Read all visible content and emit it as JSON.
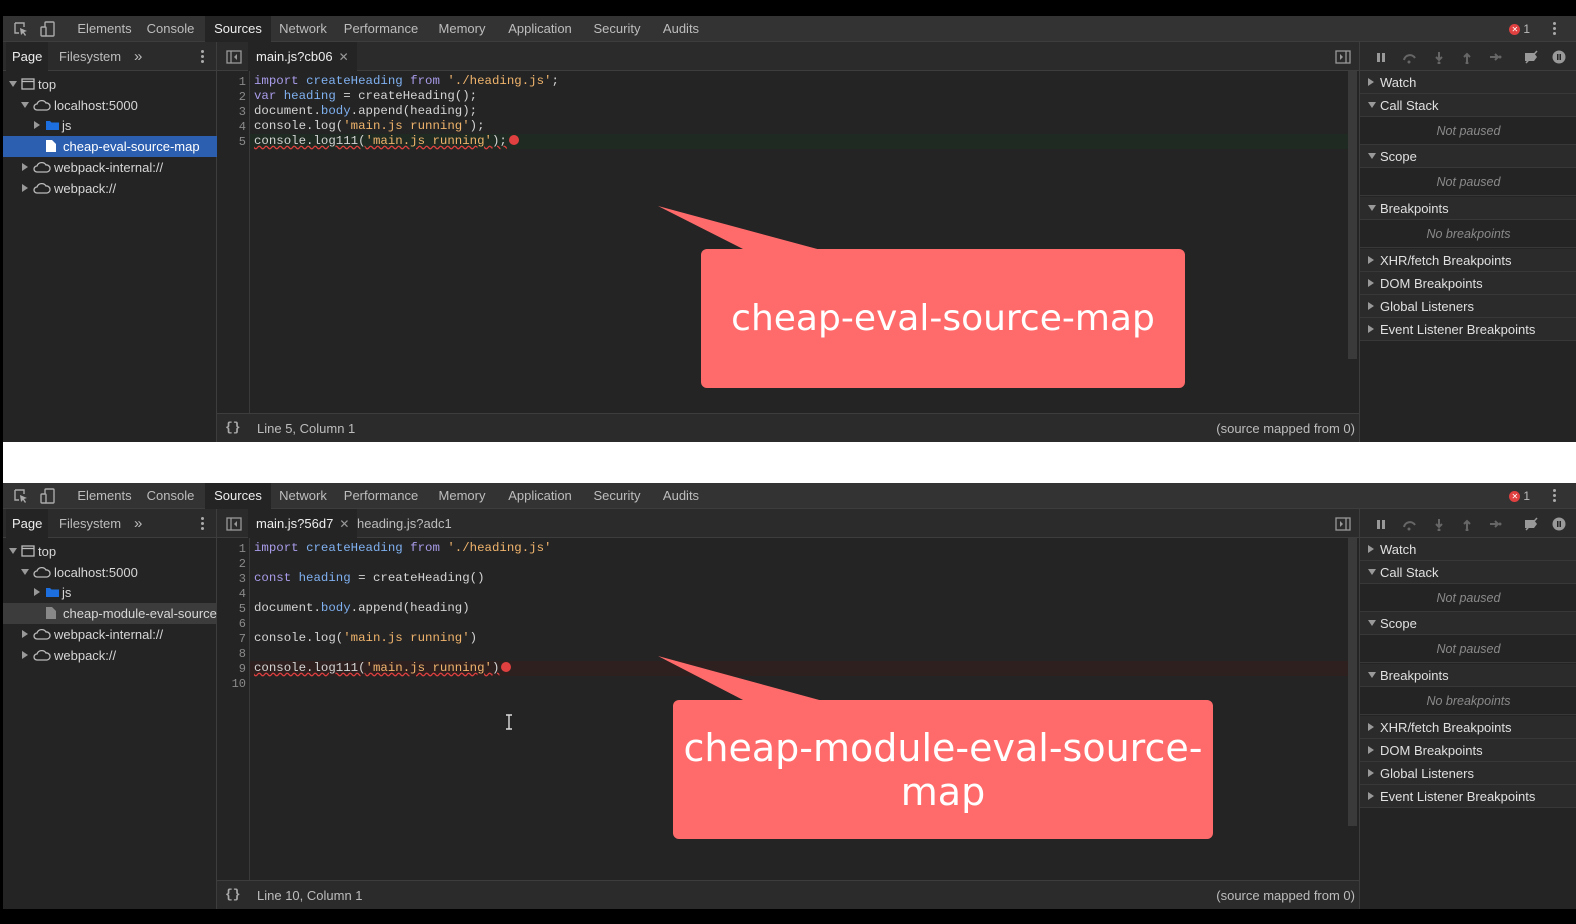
{
  "panels": [
    {
      "tabs": [
        "Elements",
        "Console",
        "Sources",
        "Network",
        "Performance",
        "Memory",
        "Application",
        "Security",
        "Audits"
      ],
      "active_tab": "Sources",
      "error_count": "1",
      "nav_tabs": [
        "Page",
        "Filesystem"
      ],
      "tree": [
        {
          "label": "top",
          "depth": 0,
          "kind": "frame",
          "open": true
        },
        {
          "label": "localhost:5000",
          "depth": 1,
          "kind": "cloud",
          "open": true
        },
        {
          "label": "js",
          "depth": 2,
          "kind": "folder",
          "open": false
        },
        {
          "label": "cheap-eval-source-map",
          "depth": 2,
          "kind": "file",
          "selected": "blue"
        },
        {
          "label": "webpack-internal://",
          "depth": 1,
          "kind": "cloud",
          "open": false
        },
        {
          "label": "webpack://",
          "depth": 1,
          "kind": "cloud",
          "open": false
        }
      ],
      "file_tabs": [
        {
          "label": "main.js?cb06",
          "active": true,
          "closable": true
        }
      ],
      "code_lines": [
        {
          "n": "1",
          "html": "<span class=\"kw\">import</span> <span class=\"vn\">createHeading</span> <span class=\"kw\">from</span> <span class=\"st\">'./heading.js'</span>;"
        },
        {
          "n": "2",
          "html": "<span class=\"kw\">var</span> <span class=\"vn\">heading</span> = createHeading();"
        },
        {
          "n": "3",
          "html": "document.<span class=\"vn\">body</span>.append(heading);"
        },
        {
          "n": "4",
          "html": "console.log(<span class=\"st\">'main.js running'</span>);"
        },
        {
          "n": "5",
          "html": "<span class=\"squig\">console.log111(<span class=\"st\">'main.js running'</span>);</span><span class=\"errx\"></span>",
          "error": true,
          "hl": "green"
        }
      ],
      "status_position": "Line 5, Column 1",
      "status_map": "(source mapped from 0)",
      "sidebar": {
        "watch": "Watch",
        "call_stack": "Call Stack",
        "call_stack_empty": "Not paused",
        "scope": "Scope",
        "scope_empty": "Not paused",
        "breakpoints": "Breakpoints",
        "breakpoints_empty": "No breakpoints",
        "xhr": "XHR/fetch Breakpoints",
        "dom": "DOM Breakpoints",
        "global": "Global Listeners",
        "event": "Event Listener Breakpoints"
      },
      "callout": "cheap-eval-source-map"
    },
    {
      "tabs": [
        "Elements",
        "Console",
        "Sources",
        "Network",
        "Performance",
        "Memory",
        "Application",
        "Security",
        "Audits"
      ],
      "active_tab": "Sources",
      "error_count": "1",
      "nav_tabs": [
        "Page",
        "Filesystem"
      ],
      "tree": [
        {
          "label": "top",
          "depth": 0,
          "kind": "frame",
          "open": true
        },
        {
          "label": "localhost:5000",
          "depth": 1,
          "kind": "cloud",
          "open": true
        },
        {
          "label": "js",
          "depth": 2,
          "kind": "folder",
          "open": false
        },
        {
          "label": "cheap-module-eval-source-",
          "depth": 2,
          "kind": "file",
          "selected": "grey"
        },
        {
          "label": "webpack-internal://",
          "depth": 1,
          "kind": "cloud",
          "open": false
        },
        {
          "label": "webpack://",
          "depth": 1,
          "kind": "cloud",
          "open": false
        }
      ],
      "file_tabs": [
        {
          "label": "main.js?56d7",
          "active": true,
          "closable": true
        },
        {
          "label": "heading.js?adc1",
          "active": false,
          "closable": false
        }
      ],
      "code_lines": [
        {
          "n": "1",
          "html": "<span class=\"kw\">import</span> <span class=\"vn\">createHeading</span> <span class=\"kw\">from</span> <span class=\"st\">'./heading.js'</span>"
        },
        {
          "n": "2",
          "html": ""
        },
        {
          "n": "3",
          "html": "<span class=\"kw\">const</span> <span class=\"vn\">heading</span> = createHeading()"
        },
        {
          "n": "4",
          "html": ""
        },
        {
          "n": "5",
          "html": "document.<span class=\"vn\">body</span>.append(heading)"
        },
        {
          "n": "6",
          "html": ""
        },
        {
          "n": "7",
          "html": "console.log(<span class=\"st\">'main.js running'</span>)"
        },
        {
          "n": "8",
          "html": ""
        },
        {
          "n": "9",
          "html": "<span class=\"squig\">console.log111(<span class=\"st\">'main.js running'</span>)</span><span class=\"errx\"></span>",
          "error": true,
          "hl": "red"
        },
        {
          "n": "10",
          "html": ""
        }
      ],
      "status_position": "Line 10, Column 1",
      "status_map": "(source mapped from 0)",
      "sidebar": {
        "watch": "Watch",
        "call_stack": "Call Stack",
        "call_stack_empty": "Not paused",
        "scope": "Scope",
        "scope_empty": "Not paused",
        "breakpoints": "Breakpoints",
        "breakpoints_empty": "No breakpoints",
        "xhr": "XHR/fetch Breakpoints",
        "dom": "DOM Breakpoints",
        "global": "Global Listeners",
        "event": "Event Listener Breakpoints"
      },
      "callout": "cheap-module-eval-source-map"
    }
  ],
  "colors": {
    "callout": "#ff6b6b",
    "selection_blue": "#2c5fb0",
    "error_red": "#e04040"
  }
}
